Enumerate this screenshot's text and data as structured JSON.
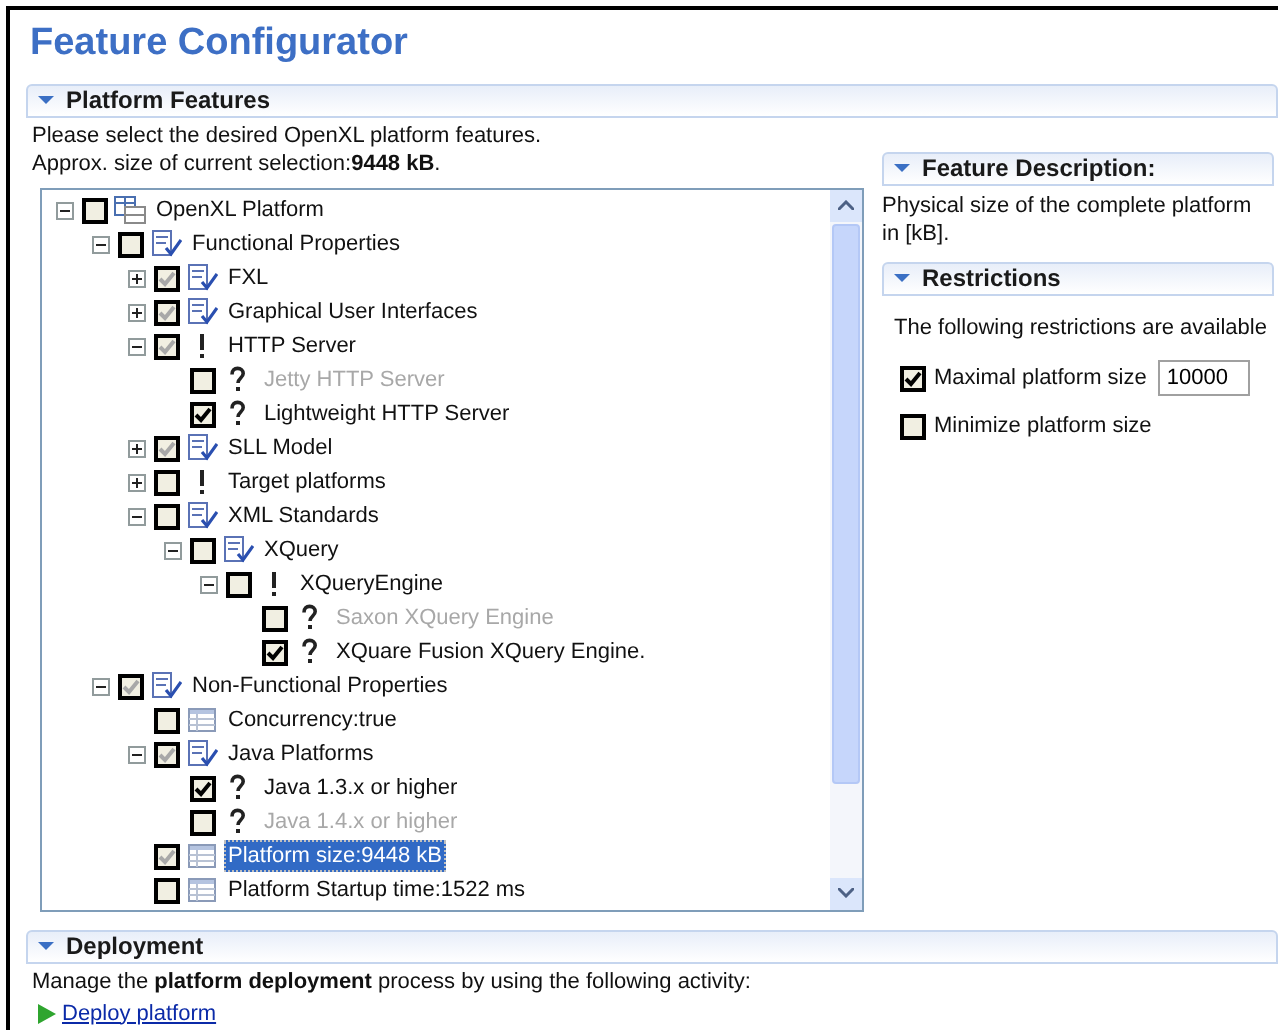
{
  "title": "Feature Configurator",
  "platform_features": {
    "header": "Platform Features",
    "expanded": true,
    "intro": "Please select the desired OpenXL platform features.",
    "size_text": "Approx. size of current selection:**9448 kB**.",
    "tree": [
      {
        "label": "OpenXL Platform",
        "kind": "platform",
        "checked": false,
        "expanded": true,
        "disabled": false,
        "selected": false,
        "children": [
          {
            "label": "Functional Properties",
            "kind": "feature",
            "checked": false,
            "expanded": true,
            "disabled": false,
            "selected": false,
            "children": [
              {
                "label": "FXL",
                "kind": "feature",
                "checked": true,
                "grayed": true,
                "expanded": false,
                "disabled": false,
                "selected": false
              },
              {
                "label": "Graphical User Interfaces",
                "kind": "feature",
                "checked": true,
                "grayed": true,
                "expanded": false,
                "disabled": false,
                "selected": false
              },
              {
                "label": "HTTP Server",
                "kind": "mandatory",
                "checked": true,
                "grayed": true,
                "expanded": true,
                "disabled": false,
                "selected": false,
                "children": [
                  {
                    "label": "Jetty HTTP Server",
                    "kind": "optional",
                    "checked": false,
                    "disabled": true,
                    "selected": false
                  },
                  {
                    "label": "Lightweight HTTP Server",
                    "kind": "optional",
                    "checked": true,
                    "disabled": false,
                    "selected": false
                  }
                ]
              },
              {
                "label": "SLL Model",
                "kind": "feature",
                "checked": true,
                "grayed": true,
                "expanded": false,
                "disabled": false,
                "selected": false
              },
              {
                "label": "Target platforms",
                "kind": "mandatory",
                "checked": false,
                "expanded": false,
                "disabled": false,
                "selected": false
              },
              {
                "label": "XML Standards",
                "kind": "feature",
                "checked": false,
                "expanded": true,
                "disabled": false,
                "selected": false,
                "children": [
                  {
                    "label": "XQuery",
                    "kind": "feature",
                    "checked": false,
                    "expanded": true,
                    "disabled": false,
                    "selected": false,
                    "children": [
                      {
                        "label": "XQueryEngine",
                        "kind": "mandatory",
                        "checked": false,
                        "expanded": true,
                        "disabled": false,
                        "selected": false,
                        "children": [
                          {
                            "label": "Saxon XQuery Engine",
                            "kind": "optional",
                            "checked": false,
                            "disabled": true,
                            "selected": false
                          },
                          {
                            "label": "XQuare Fusion XQuery Engine.",
                            "kind": "optional",
                            "checked": true,
                            "disabled": false,
                            "selected": false
                          }
                        ]
                      }
                    ]
                  }
                ]
              }
            ]
          },
          {
            "label": "Non-Functional Properties",
            "kind": "feature",
            "checked": true,
            "grayed": true,
            "expanded": true,
            "disabled": false,
            "selected": false,
            "children": [
              {
                "label": "Concurrency:true",
                "kind": "attribute",
                "checked": false,
                "disabled": false,
                "selected": false
              },
              {
                "label": "Java Platforms",
                "kind": "feature",
                "checked": true,
                "grayed": true,
                "expanded": true,
                "disabled": false,
                "selected": false,
                "children": [
                  {
                    "label": "Java 1.3.x or higher",
                    "kind": "optional",
                    "checked": true,
                    "disabled": false,
                    "selected": false
                  },
                  {
                    "label": "Java 1.4.x or higher",
                    "kind": "optional",
                    "checked": false,
                    "disabled": true,
                    "selected": false
                  }
                ]
              },
              {
                "label": "Platform size:9448 kB",
                "kind": "attribute",
                "checked": true,
                "grayed": true,
                "disabled": false,
                "selected": true
              },
              {
                "label": "Platform Startup time:1522 ms",
                "kind": "attribute",
                "checked": false,
                "disabled": false,
                "selected": false
              }
            ]
          }
        ]
      }
    ]
  },
  "feature_description": {
    "header": "Feature Description:",
    "expanded": true,
    "text": "Physical size of the complete platform in [kB]."
  },
  "restrictions": {
    "header": "Restrictions",
    "expanded": true,
    "intro": "The following restrictions are available",
    "items": [
      {
        "label": "Maximal platform size",
        "checked": true,
        "value": "10000"
      },
      {
        "label": "Minimize platform size",
        "checked": false
      }
    ]
  },
  "deployment": {
    "header": "Deployment",
    "expanded": true,
    "text": "Manage the **platform deployment** process by using the following activity:",
    "link": "Deploy platform"
  }
}
